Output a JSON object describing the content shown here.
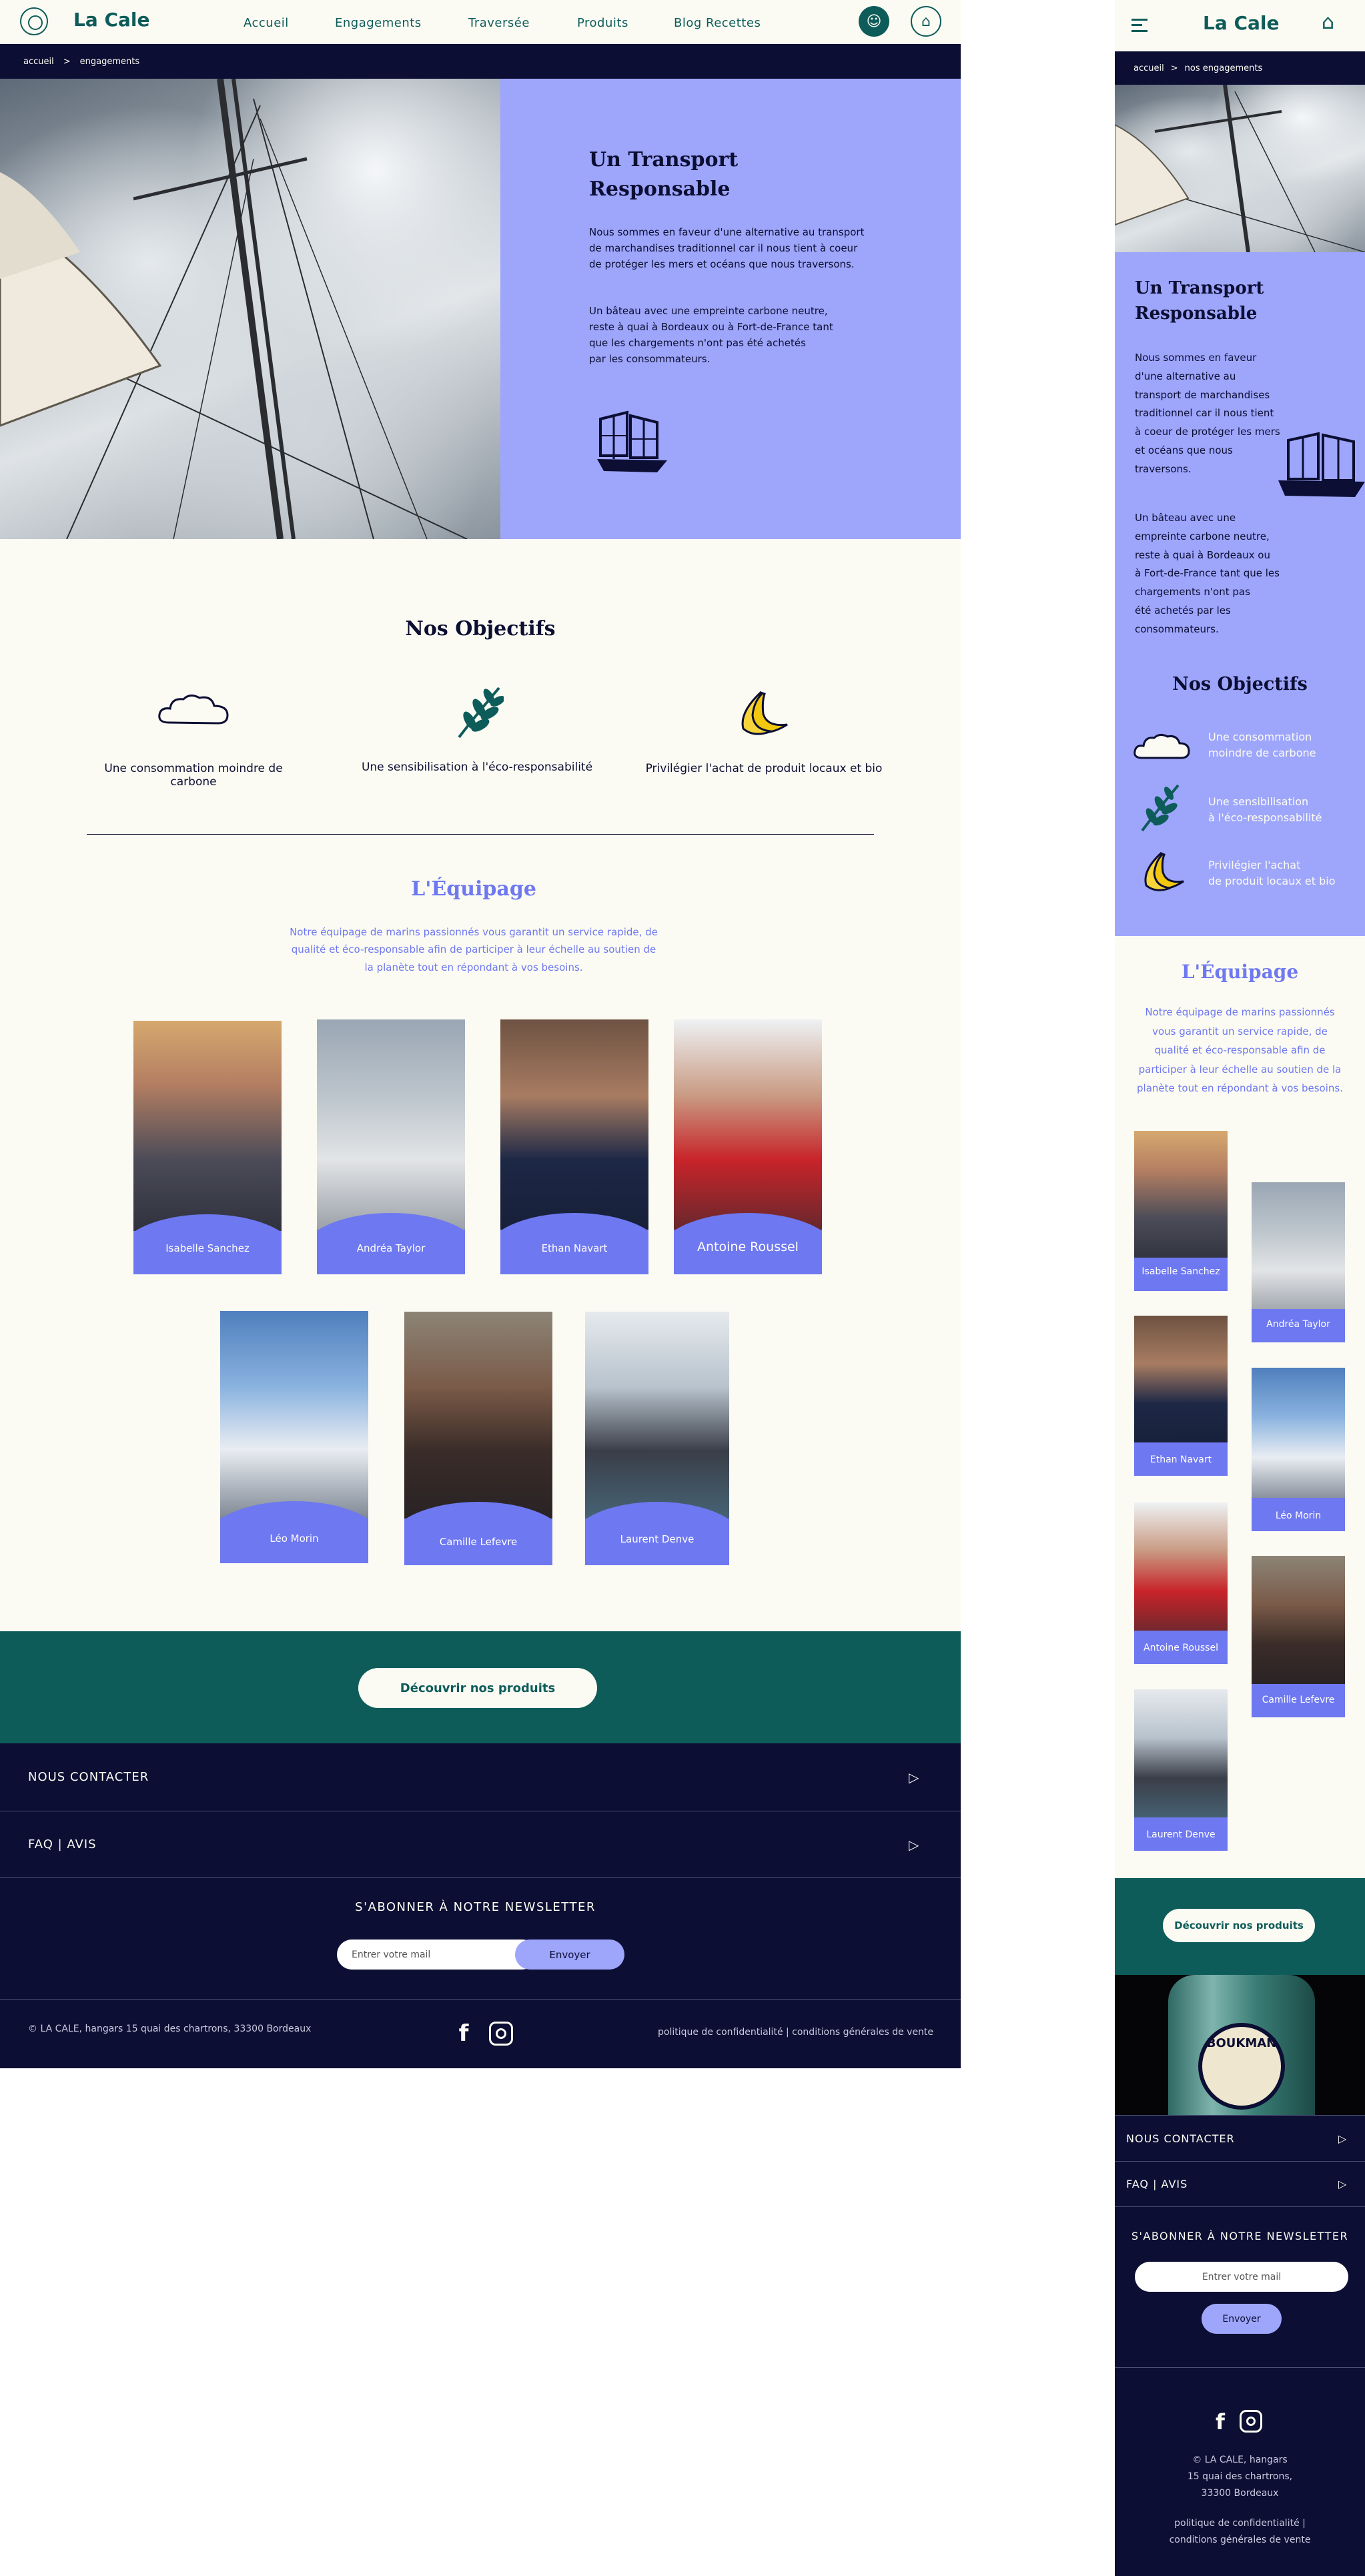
{
  "brand": "La Cale",
  "nav": [
    "Accueil",
    "Engagements",
    "Traversée",
    "Produits",
    "Blog Recettes"
  ],
  "breadcrumb": {
    "home": "accueil",
    "sep": ">",
    "desktop_current": "engagements",
    "mobile_current": "nos engagements"
  },
  "hero": {
    "title_line1": "Un Transport",
    "title_line2": "Responsable",
    "p1_desktop": [
      "Nous sommes en faveur d'une alternative au transport",
      "de marchandises traditionnel car il nous tient à coeur",
      "de protéger  les mers et océans que nous traversons."
    ],
    "p2_desktop": [
      "Un bâteau avec une empreinte carbone neutre,",
      "reste à quai à Bordeaux ou à Fort-de-France tant",
      "que les chargements n'ont pas été achetés",
      "par les consommateurs."
    ],
    "p1_mobile": [
      "Nous sommes en faveur",
      "d'une alternative au",
      "transport de marchandises",
      "traditionnel car il nous tient",
      "à coeur de protéger  les mers",
      "et océans que nous",
      "traversons."
    ],
    "p2_mobile": [
      "Un bâteau avec une",
      "empreinte carbone neutre,",
      "reste à quai à Bordeaux ou",
      "à Fort-de-France tant que les",
      "chargements n'ont pas",
      "été achetés par les",
      "consommateurs."
    ]
  },
  "objectives": {
    "title": "Nos Objectifs",
    "items": [
      {
        "label": "Une consommation moindre de carbone",
        "mobile": [
          "Une consommation",
          "moindre de carbone"
        ],
        "icon": "cloud-icon"
      },
      {
        "label": "Une sensibilisation à l'éco-responsabilité",
        "mobile": [
          "Une sensibilisation",
          "à l'éco-responsabilité"
        ],
        "icon": "leaf-icon"
      },
      {
        "label": "Privilégier l'achat de produit locaux et bio",
        "mobile": [
          "Privilégier l'achat",
          "de produit locaux et bio"
        ],
        "icon": "banana-icon"
      }
    ]
  },
  "team": {
    "title": "L'Équipage",
    "desc_desktop": [
      "Notre équipage de marins passionnés vous garantit un service rapide, de",
      "qualité et éco-responsable afin de participer à leur échelle au soutien de",
      "la planète tout en répondant à vos besoins."
    ],
    "desc_mobile": [
      "Notre équipage de marins passionnés",
      "vous garantit un service rapide, de",
      "qualité et éco-responsable afin de",
      "participer à leur échelle au soutien de la",
      "planète tout en répondant à vos besoins."
    ],
    "members": [
      "Isabelle Sanchez",
      "Andréa Taylor",
      "Ethan Navart",
      "Antoine Roussel",
      "Léo Morin",
      "Camille Lefevre",
      "Laurent Denve"
    ]
  },
  "cta": "Découvrir nos produits",
  "footer": {
    "contact": "NOUS CONTACTER",
    "faq": "FAQ | AVIS",
    "newsletter_title": "S'ABONNER À NOTRE NEWSLETTER",
    "email_placeholder": "Entrer votre mail",
    "send": "Envoyer",
    "address": "© LA CALE, hangars 15 quai des chartrons, 33300 Bordeaux",
    "address_mobile": [
      "© LA CALE, hangars",
      "15 quai des chartrons,",
      "33300 Bordeaux"
    ],
    "legal": "politique de confidentialité | conditions générales de vente",
    "legal_mobile": [
      "politique de confidentialité |",
      "conditions générales de vente"
    ],
    "bottle_label": "BOUKMAN"
  },
  "colors": {
    "teal": "#0e5c5a",
    "navy": "#0c0e33",
    "violet": "#9ea6fb",
    "periwinkle": "#6e78f0",
    "cream": "#fbfbf3"
  }
}
